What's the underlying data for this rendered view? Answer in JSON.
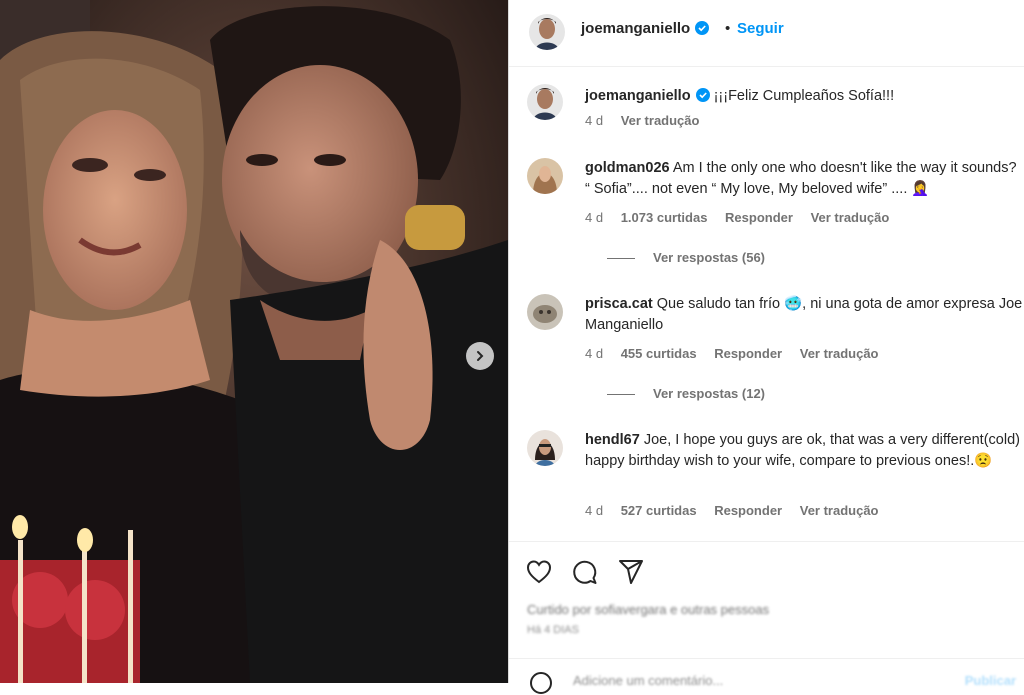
{
  "header": {
    "username": "joemanganiello",
    "separator": "•",
    "follow_label": "Seguir"
  },
  "caption": {
    "username": "joemanganiello",
    "text": "¡¡¡Feliz Cumpleaños Sofía!!!",
    "age": "4 d",
    "translate": "Ver tradução"
  },
  "comments": [
    {
      "username": "goldman026",
      "text": "Am I the only one who doesn't like the way it sounds? “ Sofia”.... not even “ My love, My beloved wife” .... 🤦‍♀️",
      "age": "4 d",
      "likes": "1.073 curtidas",
      "reply": "Responder",
      "translate": "Ver tradução",
      "replies": "Ver respostas (56)"
    },
    {
      "username": "prisca.cat",
      "text": "Que saludo tan frío 🥶, ni una gota de amor expresa Joe Manganiello",
      "age": "4 d",
      "likes": "455 curtidas",
      "reply": "Responder",
      "translate": "Ver tradução",
      "replies": "Ver respostas (12)"
    },
    {
      "username": "hendl67",
      "text": "Joe, I hope you guys are ok, that was a very different(cold) happy birthday wish to your wife, compare to previous ones!.😟",
      "age": "4 d",
      "likes": "527 curtidas",
      "reply": "Responder",
      "translate": "Ver tradução"
    }
  ],
  "footer": {
    "liked_by": "Curtido por sofiavergara e outras pessoas",
    "timestamp": "Há 4 DIAS",
    "add_comment_placeholder": "Adicione um comentário...",
    "post_label": "Publicar"
  },
  "icons": [
    "chevron-right-icon",
    "verified-icon",
    "heart-icon",
    "comment-icon",
    "share-icon",
    "emoji-icon"
  ],
  "colors": {
    "accent": "#0095f6",
    "verified": "#0095f6",
    "muted": "#737373"
  }
}
